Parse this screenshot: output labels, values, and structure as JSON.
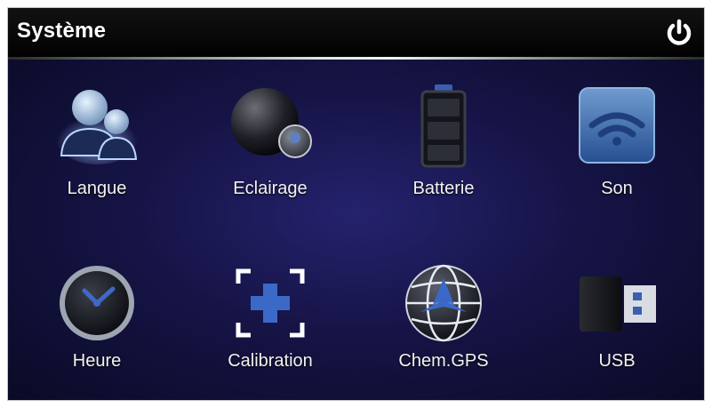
{
  "header": {
    "title": "Système",
    "power_icon": "power-icon"
  },
  "colors": {
    "accent": "#3a63b8",
    "background": "#161446",
    "titlebar": "#000000"
  },
  "grid": {
    "row1": [
      {
        "label": "Langue",
        "icon": "users-icon"
      },
      {
        "label": "Eclairage",
        "icon": "brightness-icon"
      },
      {
        "label": "Batterie",
        "icon": "battery-icon"
      },
      {
        "label": "Son",
        "icon": "sound-icon"
      }
    ],
    "row2": [
      {
        "label": "Heure",
        "icon": "clock-icon"
      },
      {
        "label": "Calibration",
        "icon": "calibration-icon"
      },
      {
        "label": "Chem.GPS",
        "icon": "gps-globe-icon"
      },
      {
        "label": "USB",
        "icon": "usb-icon"
      }
    ]
  }
}
